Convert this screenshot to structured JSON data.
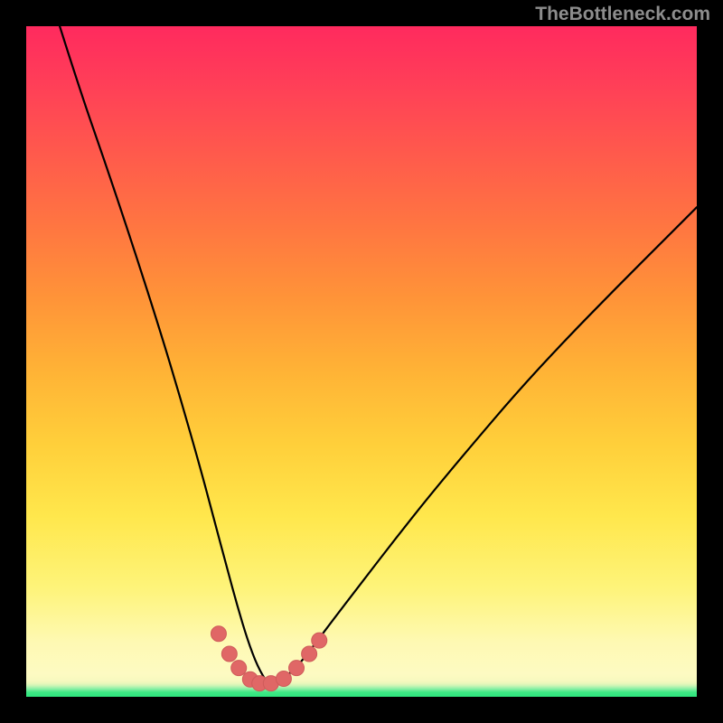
{
  "watermark": {
    "text": "TheBottleneck.com"
  },
  "colors": {
    "page_bg": "#000000",
    "line": "#000000",
    "marker_fill": "#e06766",
    "marker_stroke": "#cf5b5a",
    "gradient_top": "#ff2a5e",
    "gradient_mid": "#ffe74c",
    "gradient_bottom": "#2fe57e"
  },
  "chart_data": {
    "type": "line",
    "title": "",
    "xlabel": "",
    "ylabel": "",
    "xlim": [
      0,
      100
    ],
    "ylim": [
      0,
      100
    ],
    "legend": false,
    "grid": false,
    "description": "Bottleneck curve: sharp V-shaped dip with minimum near x≈36; coral markers cluster along the bottom of the dip on both flanks.",
    "series": [
      {
        "name": "curve",
        "type": "line",
        "x": [
          5,
          8,
          12,
          16,
          20,
          23,
          26,
          28,
          30,
          31.5,
          33,
          34.5,
          36,
          37.5,
          39,
          41,
          43,
          46,
          50,
          55,
          60,
          66,
          73,
          80,
          88,
          96,
          100
        ],
        "y": [
          100,
          90.5,
          79,
          67,
          54.5,
          44.5,
          34,
          26.5,
          19,
          13.5,
          8.5,
          4.5,
          2,
          2,
          3.2,
          5.2,
          7.8,
          11.8,
          17,
          23.5,
          29.8,
          37,
          45.2,
          52.8,
          61,
          69,
          73
        ]
      },
      {
        "name": "markers",
        "type": "scatter",
        "x": [
          28.7,
          30.3,
          31.7,
          33.4,
          34.8,
          36.5,
          38.4,
          40.3,
          42.2,
          43.7
        ],
        "y": [
          9.4,
          6.4,
          4.3,
          2.6,
          2.0,
          2.0,
          2.7,
          4.3,
          6.4,
          8.4
        ]
      }
    ]
  }
}
